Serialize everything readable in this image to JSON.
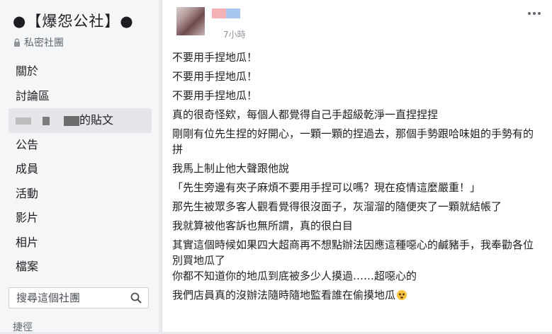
{
  "group": {
    "title": "●【爆怨公社】●",
    "privacy": "私密社團"
  },
  "sidebar": {
    "items": [
      {
        "label": "關於"
      },
      {
        "label": "討論區"
      },
      {
        "label": "的貼文"
      },
      {
        "label": "公告"
      },
      {
        "label": "成員"
      },
      {
        "label": "活動"
      },
      {
        "label": "影片"
      },
      {
        "label": "相片"
      },
      {
        "label": "檔案"
      }
    ],
    "search_placeholder": "搜尋這個社團",
    "more_label": "捷徑"
  },
  "post": {
    "timestamp": "7小時",
    "lines": [
      "不要用手捏地瓜！",
      "不要用手捏地瓜！",
      "不要用手捏地瓜！",
      "真的很奇怪欸，每個人都覺得自己手超級乾淨一直捏捏捏",
      "剛剛有位先生捏的好開心，一顆一顆的捏過去，那個手勢跟哈味姐的手勢有的拼",
      "我馬上制止他大聲跟他說",
      "「先生旁邊有夾子麻煩不要用手捏可以嗎？現在疫情這麼嚴重！」",
      "那先生被眾多客人觀看覺得很沒面子，灰溜溜的隨便夾了一顆就結帳了",
      "我就算被他客訴也無所謂，真的很白目",
      "其實這個時候如果四大超商再不想點辦法因應這種噁心的鹹豬手，我奉勸各位別買地瓜了",
      "你都不知道你的地瓜到底被多少人摸過……超噁心的",
      "我們店員真的沒辦法隨時隨地監看誰在偷摸地瓜"
    ]
  },
  "colors": {
    "sidebar_bg": "#f5f6f7",
    "active_item_bg": "#e4e6ea",
    "text": "#1c1e21",
    "muted": "#606770"
  }
}
